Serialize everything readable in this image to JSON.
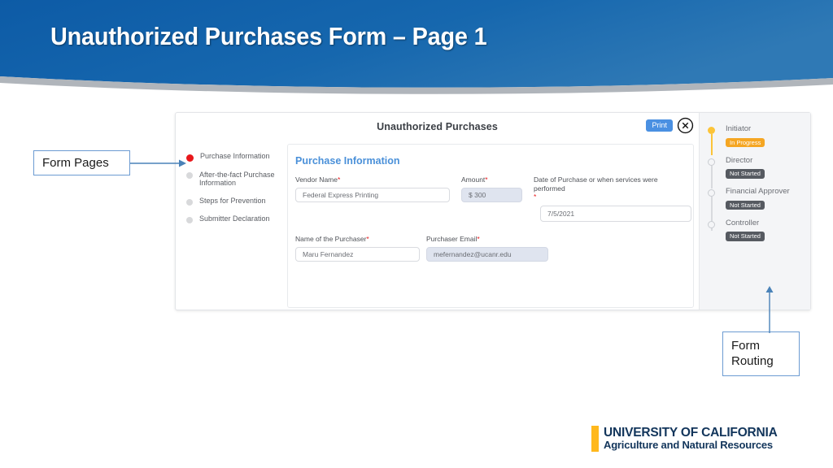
{
  "slide": {
    "title": "Unauthorized Purchases Form – Page 1",
    "banner_color_top": "#0f5ea8",
    "banner_color_bottom": "#2b75b3",
    "banner_shadow_color": "#b3b8bd"
  },
  "app": {
    "header": {
      "title": "Unauthorized Purchases",
      "print_label": "Print",
      "print_color": "#4a90e2",
      "close_icon": "close-circle-icon"
    },
    "pages_nav": {
      "items": [
        {
          "label": "Purchase Information",
          "active": true,
          "dot_color": "#e8171b"
        },
        {
          "label": "After-the-fact Purchase Information",
          "active": false,
          "dot_color": "#d8d9db"
        },
        {
          "label": "Steps for Prevention",
          "active": false,
          "dot_color": "#d8d9db"
        },
        {
          "label": "Submitter Declaration",
          "active": false,
          "dot_color": "#d8d9db"
        }
      ]
    },
    "form": {
      "section_title": "Purchase Information",
      "section_title_color": "#4a90d9",
      "fields": {
        "vendor_name": {
          "label": "Vendor Name",
          "required": true,
          "value": "Federal Express Printing"
        },
        "amount": {
          "label": "Amount",
          "required": true,
          "value": "$ 300"
        },
        "date_of_purchase": {
          "label": "Date of Purchase or when services were performed",
          "required": true,
          "value": "7/5/2021"
        },
        "purchaser_name": {
          "label": "Name of the Purchaser",
          "required": true,
          "value": "Maru Fernandez"
        },
        "purchaser_email": {
          "label": "Purchaser Email",
          "required": true,
          "value": "mefernandez@ucanr.edu"
        }
      },
      "required_marker": "*"
    },
    "routing": {
      "steps": [
        {
          "label": "Initiator",
          "status": "In Progress",
          "status_color": "#f5a623",
          "state": "done"
        },
        {
          "label": "Director",
          "status": "Not Started",
          "status_color": "#565a61",
          "state": "pending"
        },
        {
          "label": "Financial Approver",
          "status": "Not Started",
          "status_color": "#565a61",
          "state": "pending"
        },
        {
          "label": "Controller",
          "status": "Not Started",
          "status_color": "#565a61",
          "state": "pending"
        }
      ]
    }
  },
  "callouts": {
    "form_pages": "Form Pages",
    "form_routing_line1": "Form",
    "form_routing_line2": "Routing",
    "border_color": "#6c9bd2",
    "arrow_color": "#4a82b8"
  },
  "logo": {
    "line1": "UNIVERSITY OF CALIFORNIA",
    "line2": "Agriculture and Natural Resources",
    "bar_color": "#ffb81c",
    "text_color": "#12355b"
  }
}
